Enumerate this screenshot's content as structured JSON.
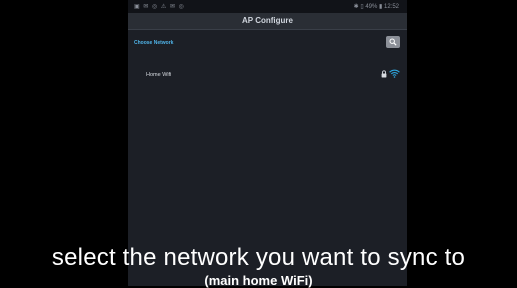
{
  "status_bar": {
    "left_icons": "▣ ✉ ◎ ⚠ ✉ ◎",
    "right_text": "✱ ▯ 49% ▮ 12:52"
  },
  "app_bar": {
    "title": "AP Configure"
  },
  "section": {
    "title": "Choose Network",
    "search_icon": "search-icon"
  },
  "networks": [
    {
      "name": "Home Wifi",
      "secured": true,
      "signal_level": 1.0
    }
  ],
  "caption": {
    "main": "select the network you want to sync to",
    "sub": "(main home WiFi)"
  },
  "colors": {
    "accent": "#4fb3e8",
    "wifi": "#2ea8e0",
    "background": "#1c1f26",
    "app_bar": "#2a2e35"
  }
}
